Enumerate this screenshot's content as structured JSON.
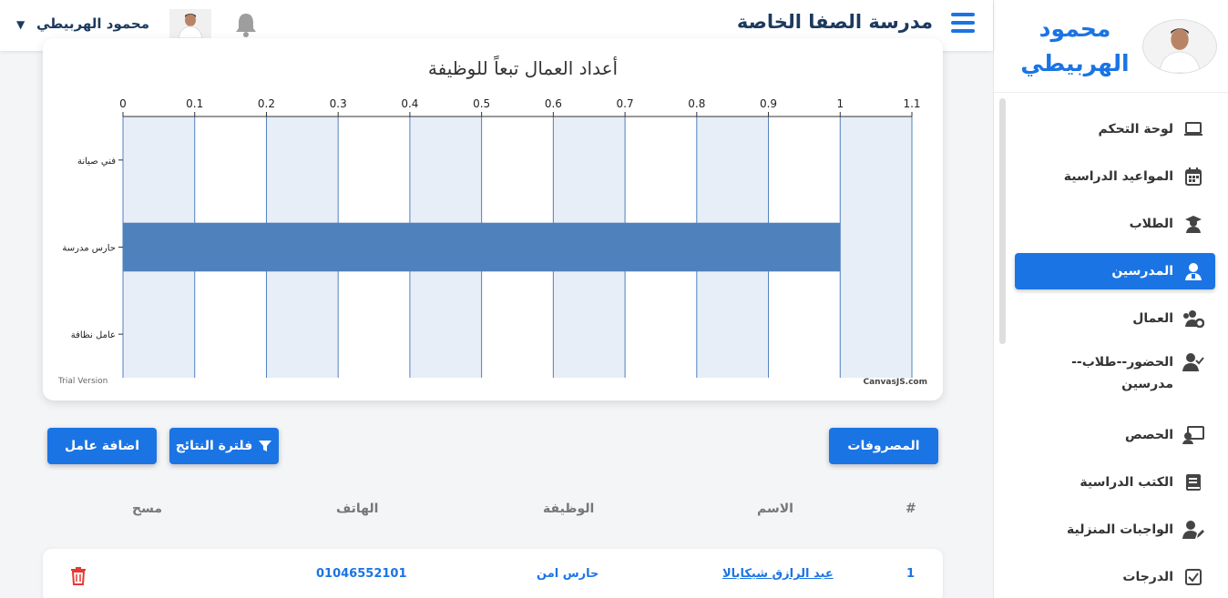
{
  "profile": {
    "name": "محمود الهربيطي"
  },
  "header": {
    "school_name": "مدرسة الصفا الخاصة",
    "user_name": "محمود الهربيطي"
  },
  "sidebar": {
    "items": [
      {
        "label": "لوحة التحكم",
        "icon": "laptop-icon",
        "active": false
      },
      {
        "label": "المواعيد الدراسية",
        "icon": "calendar-icon",
        "active": false
      },
      {
        "label": "الطلاب",
        "icon": "graduate-icon",
        "active": false
      },
      {
        "label": "المدرسين",
        "icon": "teacher-icon",
        "active": true
      },
      {
        "label": "العمال",
        "icon": "users-gear-icon",
        "active": false
      },
      {
        "label": "الحضور--طلاب--مدرسين",
        "icon": "user-check-icon",
        "active": false
      },
      {
        "label": "الحصص",
        "icon": "chalkboard-icon",
        "active": false
      },
      {
        "label": "الكتب الدراسية",
        "icon": "book-icon",
        "active": false
      },
      {
        "label": "الواجبات المنزلية",
        "icon": "user-edit-icon",
        "active": false
      },
      {
        "label": "الدرجات",
        "icon": "checkbox-icon",
        "active": false
      }
    ]
  },
  "chart_data": {
    "type": "bar",
    "orientation": "horizontal",
    "title": "أعداد العمال تبعاً للوظيفة",
    "categories": [
      "فني صيانة",
      "حارس مدرسة",
      "عامل نظافة"
    ],
    "values": [
      0,
      1,
      0
    ],
    "xlim": [
      0,
      1.1
    ],
    "ticks": [
      "0",
      "0.1",
      "0.2",
      "0.3",
      "0.4",
      "0.5",
      "0.6",
      "0.7",
      "0.8",
      "0.9",
      "1",
      "1.1"
    ],
    "grid": true,
    "bar_color": "#4f81bc",
    "band_color": "#e8eef7",
    "watermark_left": "Trial Version",
    "watermark_right": "CanvasJS.com"
  },
  "buttons": {
    "expenses": "المصروفات",
    "filter": "فلترة النتائج",
    "add_worker": "اضافة عامل"
  },
  "table": {
    "headers": {
      "num": "#",
      "name": "الاسم",
      "job": "الوظيفة",
      "phone": "الهاتف",
      "delete": "مسح"
    },
    "rows": [
      {
        "num": "1",
        "name": "عبد الرازق شيكابالا",
        "job": "حارس امن",
        "phone": "01046552101"
      }
    ]
  },
  "colors": {
    "accent": "#1b74e4",
    "danger": "#e53935",
    "title": "#1c3a5e"
  }
}
